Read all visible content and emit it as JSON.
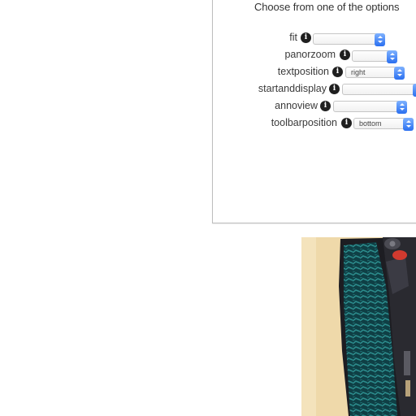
{
  "options_panel": {
    "heading": "Choose from one of the options",
    "rows": [
      {
        "label": "fit",
        "value": ""
      },
      {
        "label": "panorzoom",
        "value": ""
      },
      {
        "label": "textposition",
        "value": "right"
      },
      {
        "label": "startanddisplay",
        "value": ""
      },
      {
        "label": "annoview",
        "value": ""
      },
      {
        "label": "toolbarposition",
        "value": "bottom"
      }
    ]
  },
  "icons": {
    "info": "info-circle-icon",
    "select_arrow": "dropdown-arrows-icon"
  },
  "colors": {
    "select_accent": "#2a6ff0",
    "panel_border": "#bdbdbd",
    "artwork_background": "#f1dcae",
    "artwork_fabric": "#1f6f72"
  },
  "artwork": {
    "name": "woodblock-print-figure"
  }
}
